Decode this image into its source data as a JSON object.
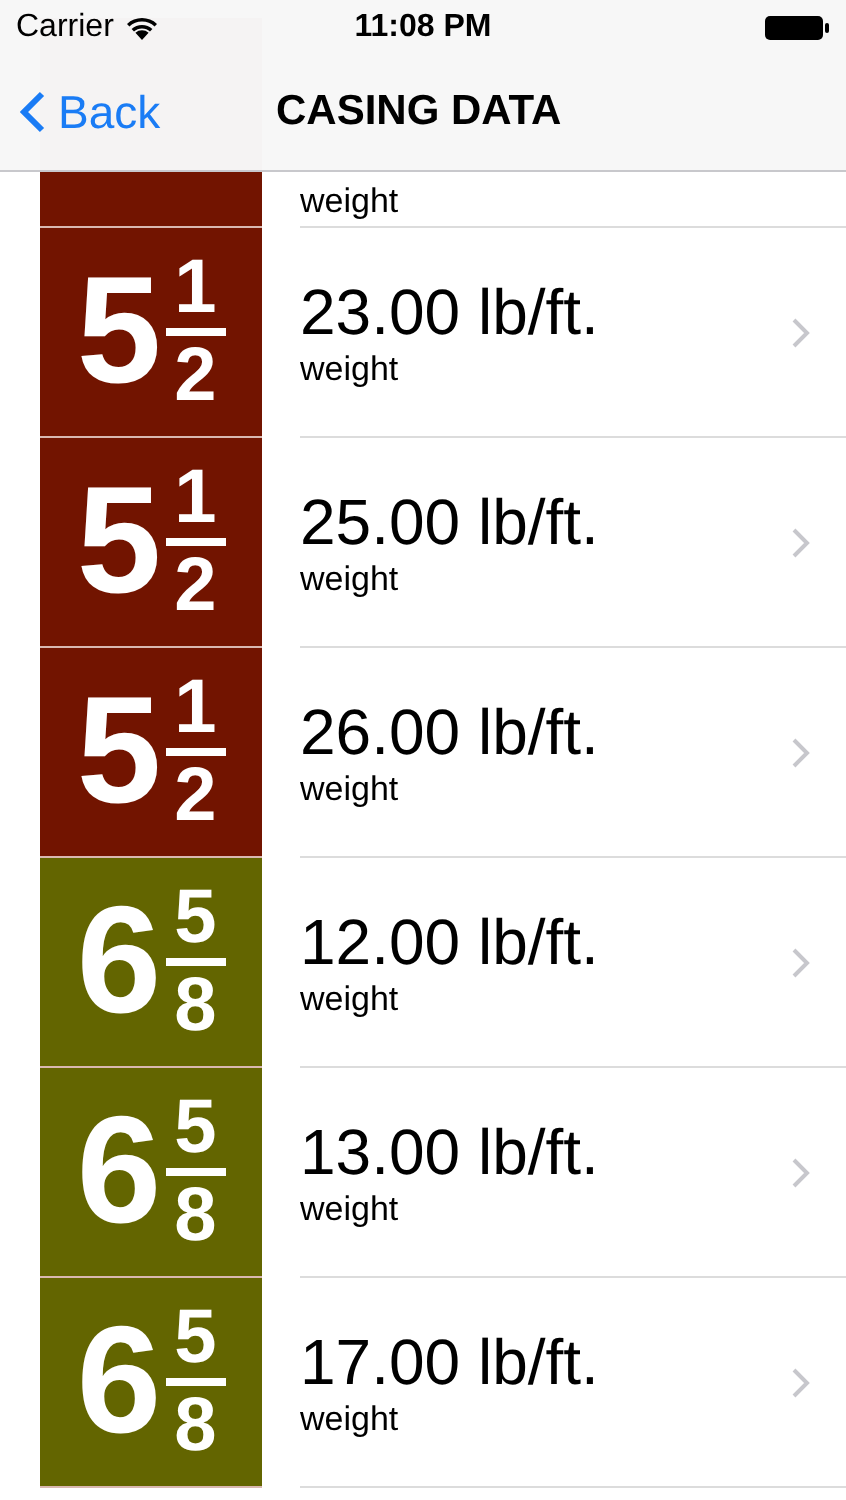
{
  "status_bar": {
    "carrier": "Carrier",
    "time": "11:08 PM"
  },
  "nav_bar": {
    "back": "Back",
    "title": "CASING DATA"
  },
  "rows": [
    {
      "color": "#721400",
      "subtitle": "weight"
    },
    {
      "whole": "5",
      "numerator": "1",
      "denominator": "2",
      "color": "#721400",
      "title": "23.00 lb/ft.",
      "subtitle": "weight"
    },
    {
      "whole": "5",
      "numerator": "1",
      "denominator": "2",
      "color": "#721400",
      "title": "25.00 lb/ft.",
      "subtitle": "weight"
    },
    {
      "whole": "5",
      "numerator": "1",
      "denominator": "2",
      "color": "#721400",
      "title": "26.00 lb/ft.",
      "subtitle": "weight"
    },
    {
      "whole": "6",
      "numerator": "5",
      "denominator": "8",
      "color": "#636500",
      "title": "12.00 lb/ft.",
      "subtitle": "weight"
    },
    {
      "whole": "6",
      "numerator": "5",
      "denominator": "8",
      "color": "#636500",
      "title": "13.00 lb/ft.",
      "subtitle": "weight"
    },
    {
      "whole": "6",
      "numerator": "5",
      "denominator": "8",
      "color": "#636500",
      "title": "17.00 lb/ft.",
      "subtitle": "weight"
    }
  ]
}
